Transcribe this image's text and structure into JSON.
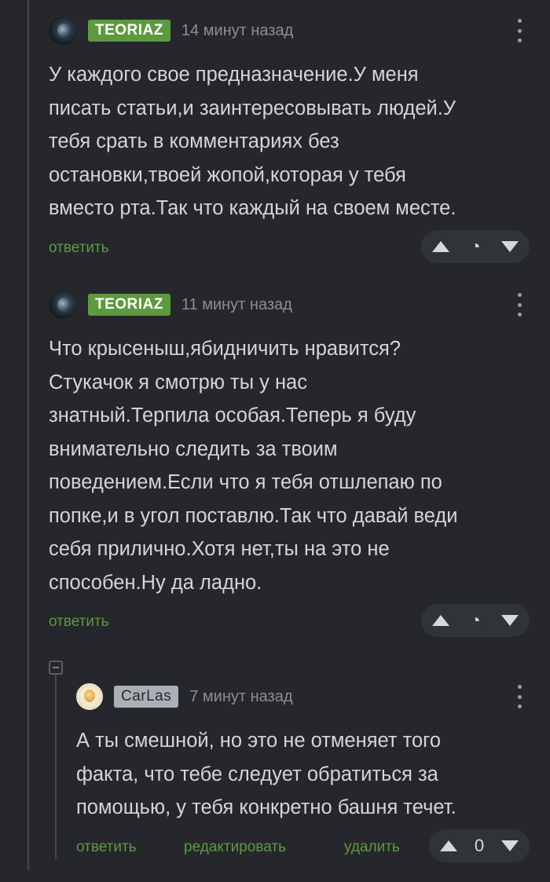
{
  "comments": [
    {
      "author": "TEORIAZ",
      "time": "14 минут назад",
      "text": "У каждого свое предназначение.У меня\nписать статьи,и заинтересовывать людей.У\nтебя срать в комментариях без\nостановки,твоей жопой,которая у тебя\nвместо рта.Так что каждый на своем месте.",
      "reply_label": "ответить",
      "rating_icon": "hidden-rating-icon"
    },
    {
      "author": "TEORIAZ",
      "time": "11 минут назад",
      "text": "Что крысеныш,ябидничить нравится?\nСтукачок я смотрю ты у нас\nзнатный.Терпила особая.Теперь я буду\nвнимательно следить за твоим\nповедением.Если что я тебя отшлепаю по\nпопке,и в угол поставлю.Так что давай веди\nсебя прилично.Хотя нет,ты на это не\nспособен.Ну да ладно.",
      "reply_label": "ответить",
      "rating_icon": "hidden-rating-icon"
    },
    {
      "author": "CarLas",
      "time": "7 минут назад",
      "text": "А ты смешной, но это не отменяет того\nфакта, что тебе следует обратиться за\nпомощью, у тебя конкретно башня течет.",
      "reply_label": "ответить",
      "edit_label": "редактировать",
      "delete_label": "удалить",
      "rating": "0"
    }
  ],
  "colors": {
    "background": "#25272c",
    "accent_green": "#5d9a3f",
    "text": "#d4d5d7",
    "muted": "#8b8f95"
  }
}
